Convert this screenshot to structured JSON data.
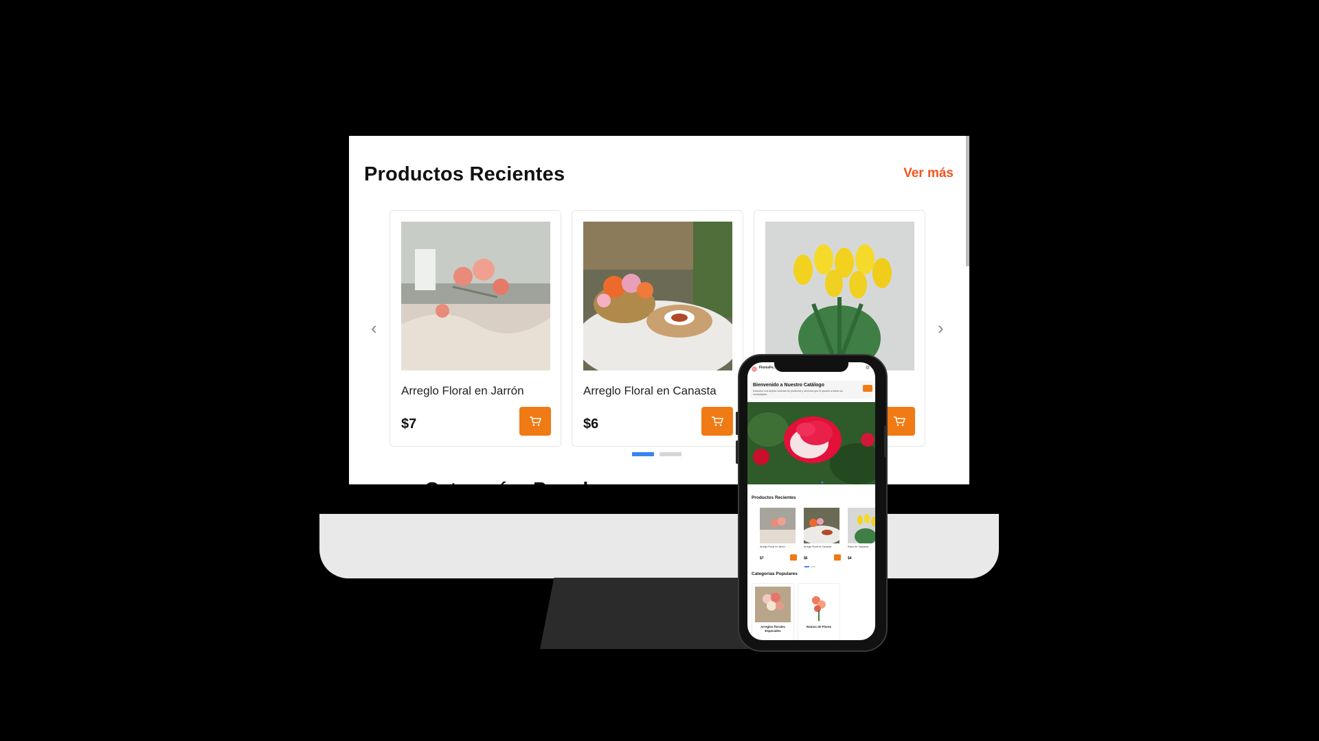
{
  "desktop": {
    "section_title": "Productos Recientes",
    "see_more": "Ver más",
    "products": [
      {
        "name": "Arreglo Floral en Jarrón",
        "price": "$7"
      },
      {
        "name": "Arreglo Floral en Canasta",
        "price": "$6"
      },
      {
        "name": "",
        "price": ""
      }
    ],
    "carousel": {
      "active_dot": 1,
      "dots": 2
    },
    "next_section_title": "Categorías Populares"
  },
  "phone": {
    "brand": "FloresFe...",
    "banner_title": "Bienvenido a Nuestro Catálogo",
    "banner_text": "Descubre una amplia variedad de productos y servicios que te ayuden a todas tus necesidades.",
    "recent_title": "Productos Recientes",
    "products": [
      {
        "name": "Arreglo Floral en Jarrón",
        "price": "$7"
      },
      {
        "name": "Arreglo Floral en Canasta",
        "price": "$6"
      },
      {
        "name": "Ramo de Tulipanes",
        "price": "$4"
      }
    ],
    "categories_title": "Categorías Populares",
    "categories": [
      {
        "name": "Arreglos florales Especiales"
      },
      {
        "name": "Ramos de Flores"
      }
    ]
  },
  "colors": {
    "accent": "#f07a14",
    "link": "#f2551d",
    "dot_active": "#3b82f6"
  },
  "icons": [
    "cart-icon",
    "chevron-left-icon",
    "chevron-right-icon",
    "gear-icon"
  ]
}
